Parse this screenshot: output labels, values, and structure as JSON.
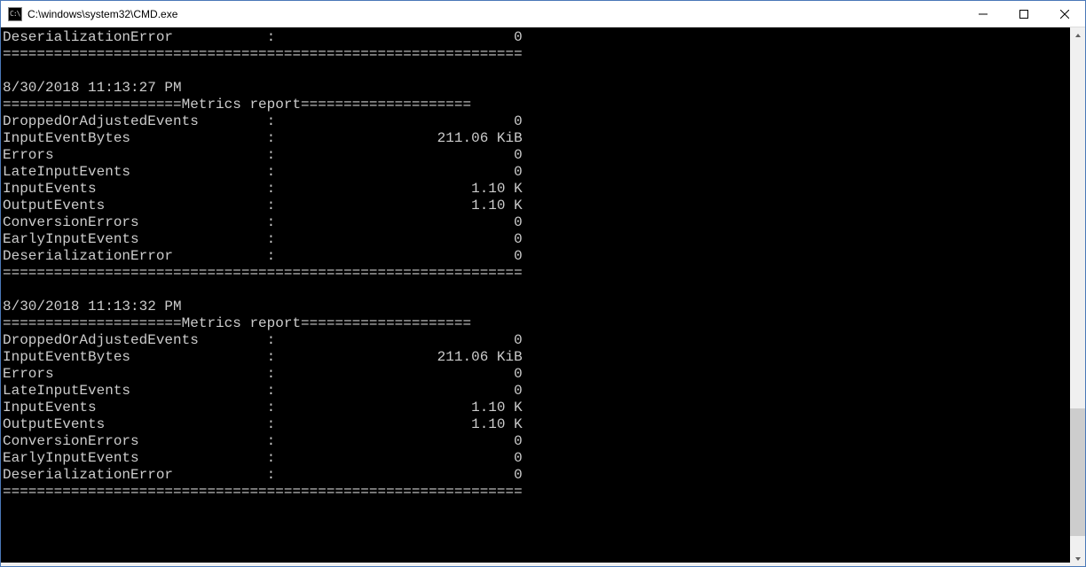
{
  "window": {
    "title": "C:\\windows\\system32\\CMD.exe",
    "icon_label": "C:\\"
  },
  "partial_top": {
    "name": "DeserializationError",
    "value": "0"
  },
  "separator": "=============================================================",
  "reports": [
    {
      "timestamp": "8/30/2018 11:13:27 PM",
      "header_prefix": "=====================",
      "header_label": "Metrics report",
      "header_suffix": "====================",
      "rows": [
        {
          "name": "DroppedOrAdjustedEvents",
          "value": "0"
        },
        {
          "name": "InputEventBytes",
          "value": "211.06 KiB"
        },
        {
          "name": "Errors",
          "value": "0"
        },
        {
          "name": "LateInputEvents",
          "value": "0"
        },
        {
          "name": "InputEvents",
          "value": "1.10 K"
        },
        {
          "name": "OutputEvents",
          "value": "1.10 K"
        },
        {
          "name": "ConversionErrors",
          "value": "0"
        },
        {
          "name": "EarlyInputEvents",
          "value": "0"
        },
        {
          "name": "DeserializationError",
          "value": "0"
        }
      ]
    },
    {
      "timestamp": "8/30/2018 11:13:32 PM",
      "header_prefix": "=====================",
      "header_label": "Metrics report",
      "header_suffix": "====================",
      "rows": [
        {
          "name": "DroppedOrAdjustedEvents",
          "value": "0"
        },
        {
          "name": "InputEventBytes",
          "value": "211.06 KiB"
        },
        {
          "name": "Errors",
          "value": "0"
        },
        {
          "name": "LateInputEvents",
          "value": "0"
        },
        {
          "name": "InputEvents",
          "value": "1.10 K"
        },
        {
          "name": "OutputEvents",
          "value": "1.10 K"
        },
        {
          "name": "ConversionErrors",
          "value": "0"
        },
        {
          "name": "EarlyInputEvents",
          "value": "0"
        },
        {
          "name": "DeserializationError",
          "value": "0"
        }
      ]
    }
  ],
  "scrollbar": {
    "thumb_top_pct": 72,
    "thumb_height_pct": 25
  }
}
